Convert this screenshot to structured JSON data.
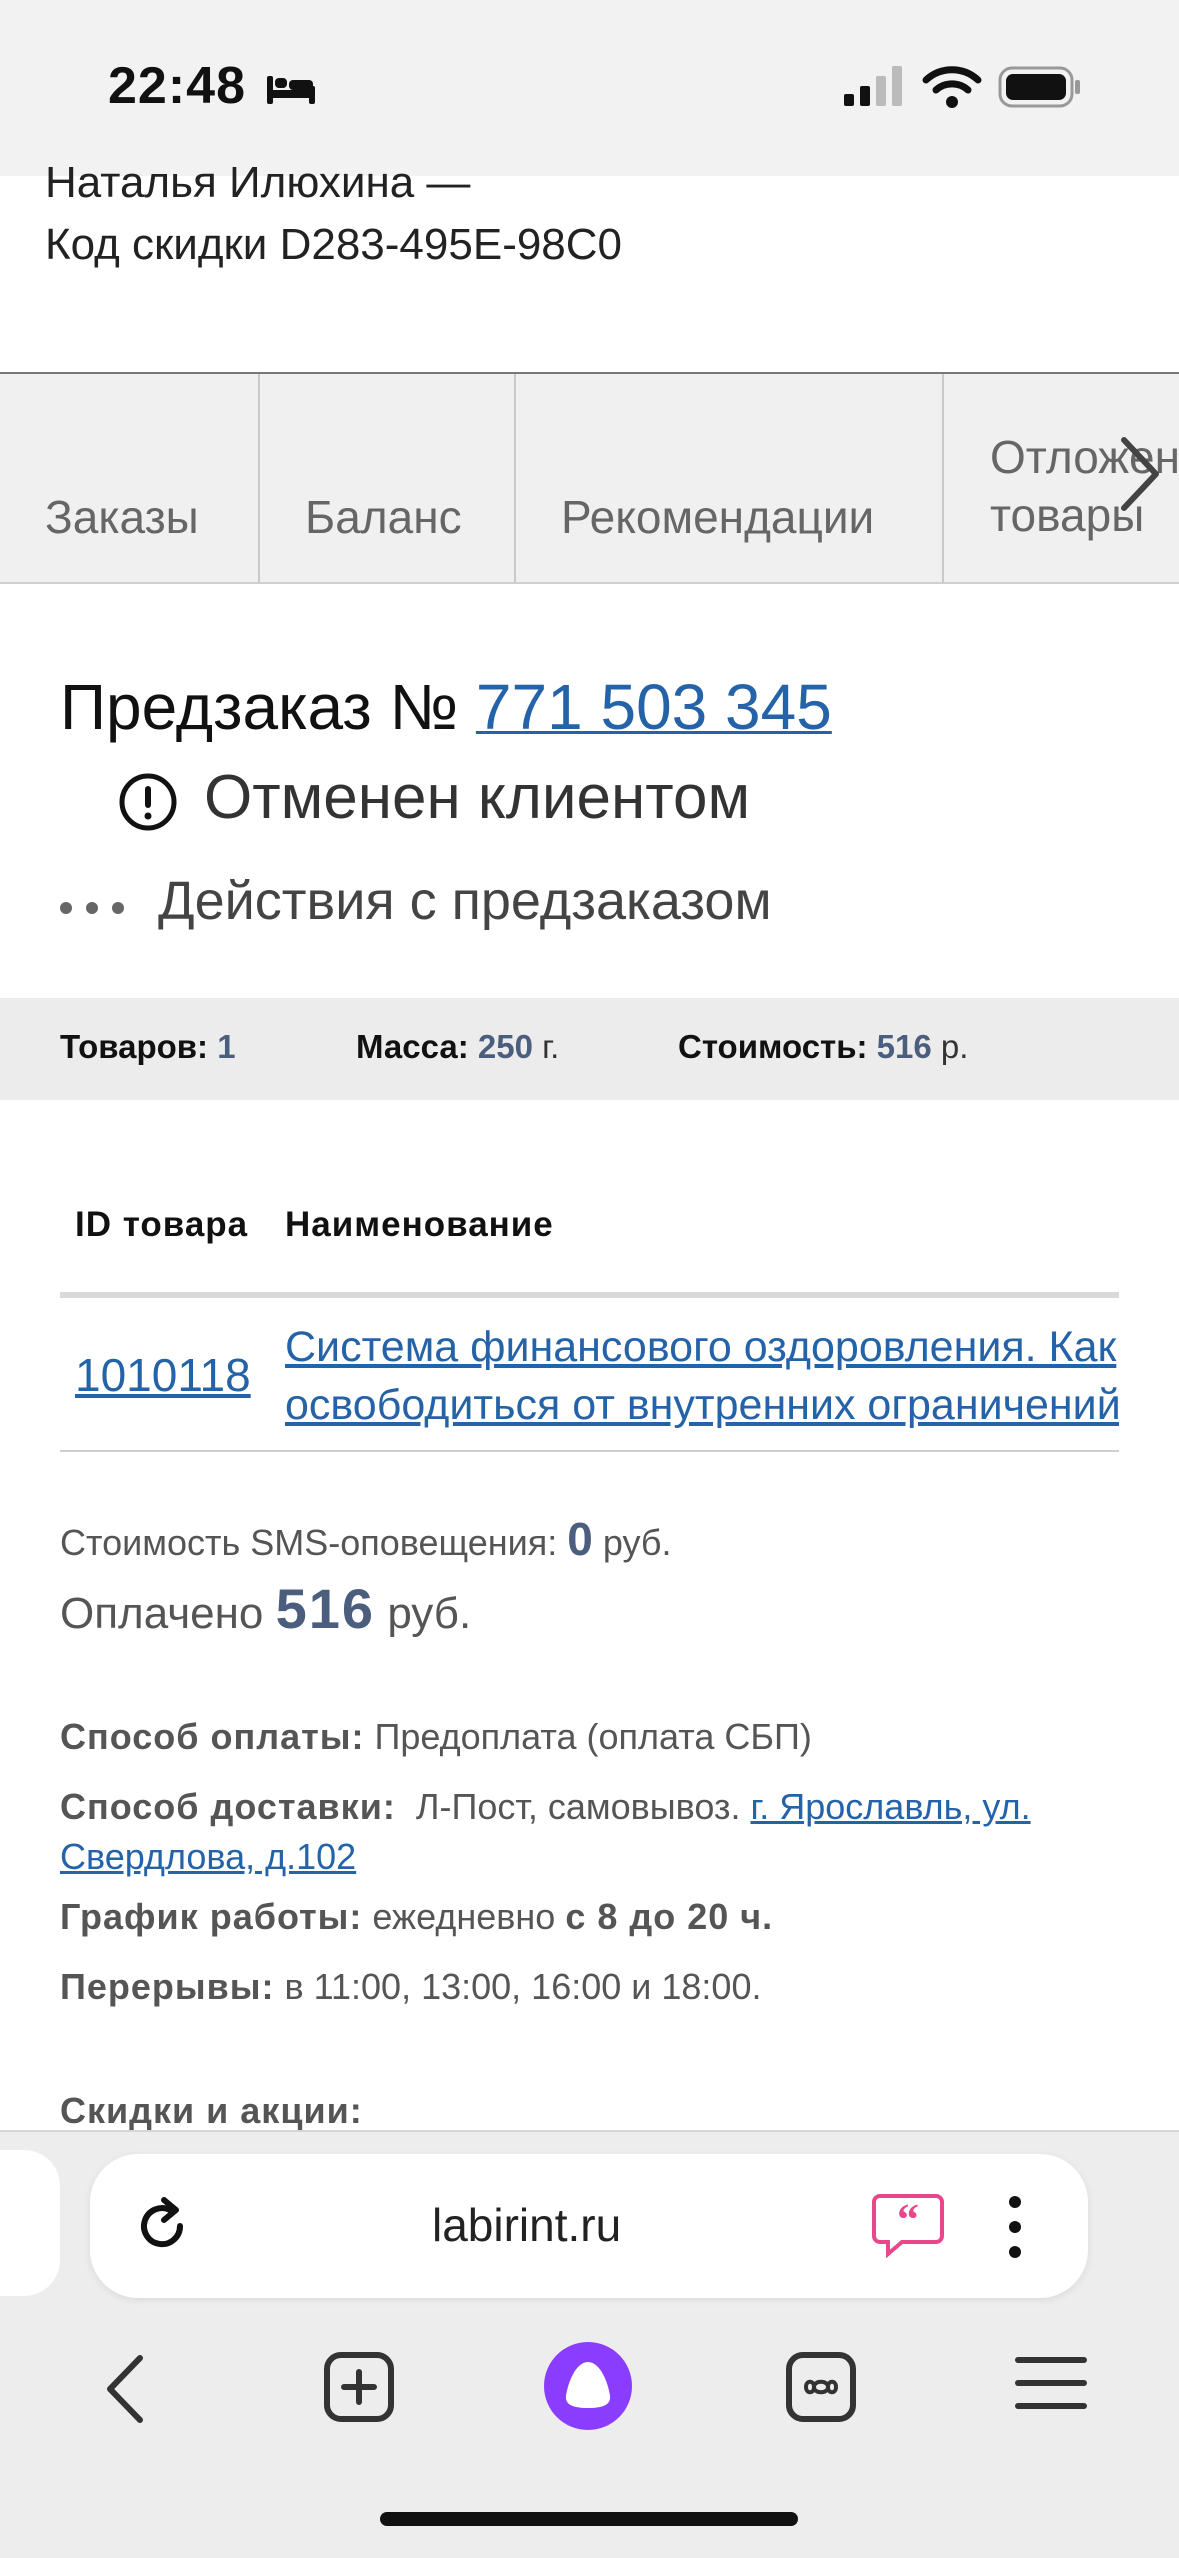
{
  "status_bar": {
    "time": "22:48"
  },
  "header": {
    "user_line": "Наталья Илюхина —",
    "discount_code": "Код скидки D283-495E-98C0"
  },
  "tabs": [
    "Заказы",
    "Баланс",
    "Рекомендации",
    "Отложенные товары"
  ],
  "preorder": {
    "title_prefix": "Предзаказ №",
    "number": "771 503 345",
    "status": "Отменен клиентом",
    "actions_label": "Действия с предзаказом"
  },
  "summary": {
    "items_label": "Товаров:",
    "items_value": "1",
    "weight_label": "Масса:",
    "weight_value": "250",
    "weight_unit": "г.",
    "cost_label": "Стоимость:",
    "cost_value": "516",
    "cost_unit": "р."
  },
  "table": {
    "headers": [
      "ID товара",
      "Наименование"
    ],
    "rows": [
      {
        "id": "1010118",
        "name_line1": "Система финансового оздоровления. Как",
        "name_line2": "освободиться от внутренних ограничений"
      }
    ]
  },
  "payment": {
    "sms_label": "Стоимость SMS-оповещения:",
    "sms_value": "0",
    "sms_unit": "руб.",
    "paid_label": "Оплачено",
    "paid_value": "516",
    "paid_unit": "руб.",
    "method_label": "Способ оплаты:",
    "method_value": "Предоплата (оплата СБП)",
    "delivery_label": "Способ доставки:",
    "delivery_value": "Л-Пост, самовывоз.",
    "delivery_address": "г. Ярославль, ул. Свердлова, д.102",
    "schedule_label": "График работы:",
    "schedule_value": "ежедневно",
    "schedule_hours": "с 8 до 20 ч.",
    "breaks_label": "Перерывы:",
    "breaks_value": "в 11:00, 13:00, 16:00 и 18:00.",
    "discounts_label": "Скидки и акции:"
  },
  "browser": {
    "url": "labirint.ru"
  },
  "colors": {
    "link": "#2563a8",
    "value": "#4b5e7d",
    "alice": "#8b3dff",
    "quote": "#e8488a"
  }
}
